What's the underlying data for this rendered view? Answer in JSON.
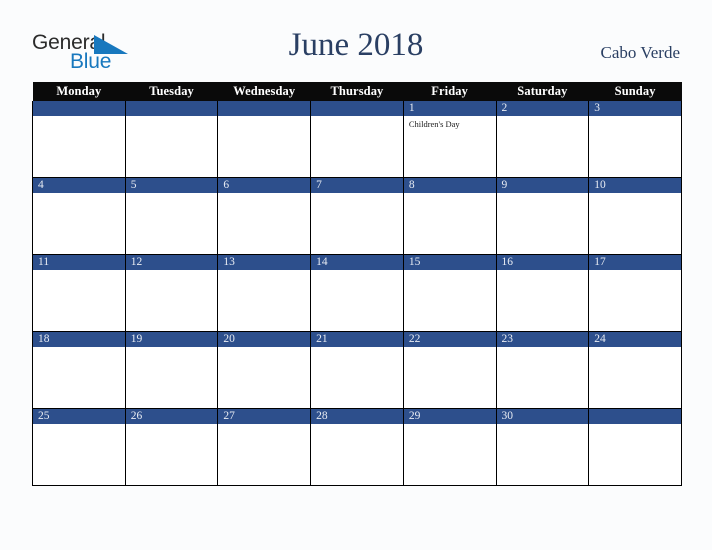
{
  "brand": {
    "name_part1": "General",
    "name_part2": "Blue",
    "triangle_icon": "blue-triangle-icon",
    "colors": {
      "general_text": "#2b2b2b",
      "blue_text": "#1878be",
      "triangle": "#1878be"
    }
  },
  "header": {
    "title": "June 2018",
    "country": "Cabo Verde",
    "title_color": "#2a3f63"
  },
  "calendar": {
    "month": "June",
    "year": "2018",
    "weekday_headers": [
      "Monday",
      "Tuesday",
      "Wednesday",
      "Thursday",
      "Friday",
      "Saturday",
      "Sunday"
    ],
    "header_bg": "#0a0a0a",
    "daybar_bg": "#2d4f8c",
    "daybar_text": "#e8ecf3",
    "cell_bg": "#ffffff",
    "page_bg": "#fbfcfd",
    "weeks": [
      [
        {
          "date": "",
          "events": []
        },
        {
          "date": "",
          "events": []
        },
        {
          "date": "",
          "events": []
        },
        {
          "date": "",
          "events": []
        },
        {
          "date": "1",
          "events": [
            "Children's Day"
          ]
        },
        {
          "date": "2",
          "events": []
        },
        {
          "date": "3",
          "events": []
        }
      ],
      [
        {
          "date": "4",
          "events": []
        },
        {
          "date": "5",
          "events": []
        },
        {
          "date": "6",
          "events": []
        },
        {
          "date": "7",
          "events": []
        },
        {
          "date": "8",
          "events": []
        },
        {
          "date": "9",
          "events": []
        },
        {
          "date": "10",
          "events": []
        }
      ],
      [
        {
          "date": "11",
          "events": []
        },
        {
          "date": "12",
          "events": []
        },
        {
          "date": "13",
          "events": []
        },
        {
          "date": "14",
          "events": []
        },
        {
          "date": "15",
          "events": []
        },
        {
          "date": "16",
          "events": []
        },
        {
          "date": "17",
          "events": []
        }
      ],
      [
        {
          "date": "18",
          "events": []
        },
        {
          "date": "19",
          "events": []
        },
        {
          "date": "20",
          "events": []
        },
        {
          "date": "21",
          "events": []
        },
        {
          "date": "22",
          "events": []
        },
        {
          "date": "23",
          "events": []
        },
        {
          "date": "24",
          "events": []
        }
      ],
      [
        {
          "date": "25",
          "events": []
        },
        {
          "date": "26",
          "events": []
        },
        {
          "date": "27",
          "events": []
        },
        {
          "date": "28",
          "events": []
        },
        {
          "date": "29",
          "events": []
        },
        {
          "date": "30",
          "events": []
        },
        {
          "date": "",
          "events": []
        }
      ]
    ]
  }
}
